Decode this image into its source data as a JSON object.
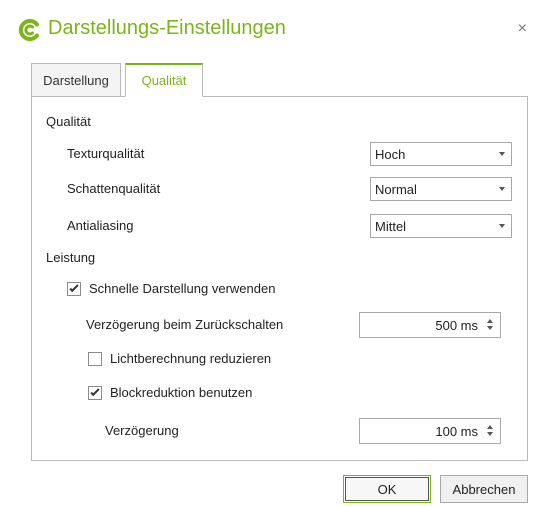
{
  "dialog": {
    "title": "Darstellungs-Einstellungen",
    "close_symbol": "×",
    "logo_icon": "c-logo-icon",
    "accent_color": "#7cb518"
  },
  "tabs": [
    {
      "label": "Darstellung",
      "active": false
    },
    {
      "label": "Qualität",
      "active": true
    }
  ],
  "quality": {
    "section_label": "Qualität",
    "texture": {
      "label": "Texturqualität",
      "value": "Hoch"
    },
    "shadow": {
      "label": "Schattenqualität",
      "value": "Normal"
    },
    "antialiasing": {
      "label": "Antialiasing",
      "value": "Mittel"
    }
  },
  "performance": {
    "section_label": "Leistung",
    "fast_render": {
      "label": "Schnelle Darstellung verwenden",
      "checked": true
    },
    "switch_back_delay": {
      "label": "Verzögerung beim Zurückschalten",
      "value": "500 ms"
    },
    "reduce_lighting": {
      "label": "Lichtberechnung reduzieren",
      "checked": false
    },
    "block_reduction": {
      "label": "Blockreduktion benutzen",
      "checked": true
    },
    "delay": {
      "label": "Verzögerung",
      "value": "100 ms"
    }
  },
  "buttons": {
    "ok": "OK",
    "cancel": "Abbrechen"
  }
}
